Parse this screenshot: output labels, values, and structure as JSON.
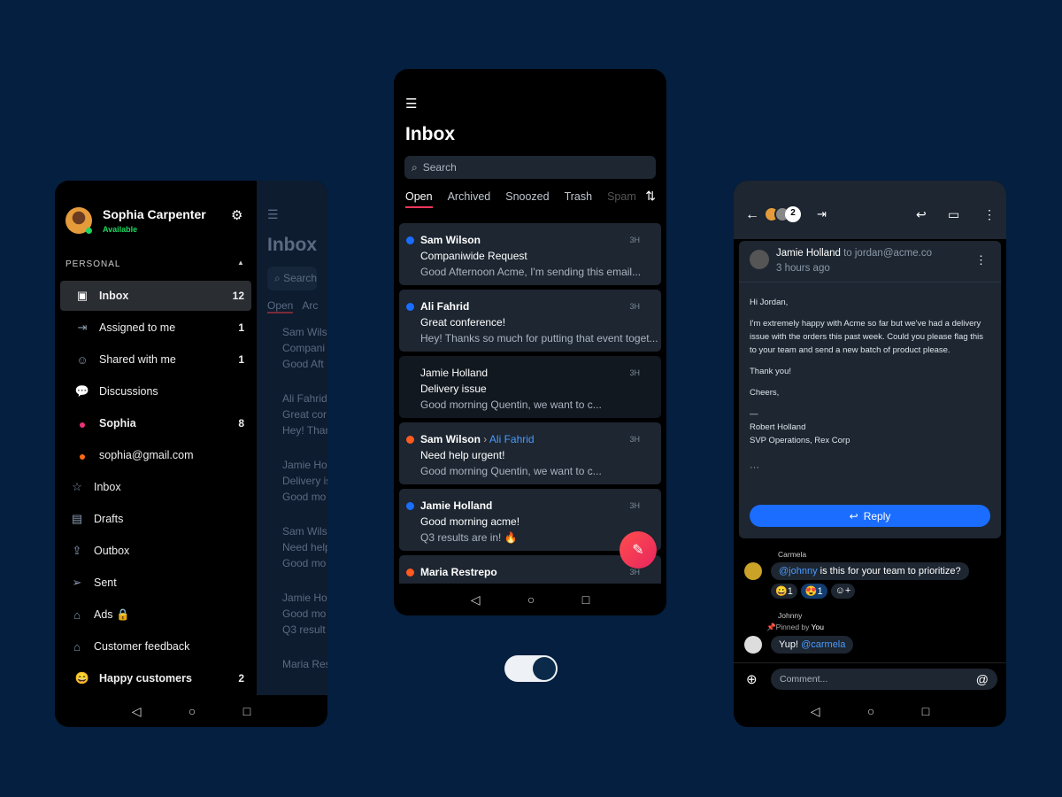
{
  "left": {
    "user": {
      "name": "Sophia Carpenter",
      "status": "Available"
    },
    "section": "PERSONAL",
    "items": [
      {
        "icon": "inbox-icon",
        "glyph": "▣",
        "label": "Inbox",
        "count": "12",
        "active": true
      },
      {
        "icon": "assign-icon",
        "glyph": "⇥",
        "label": "Assigned to me",
        "count": "1"
      },
      {
        "icon": "shared-icon",
        "glyph": "☺",
        "label": "Shared with me",
        "count": "1"
      },
      {
        "icon": "discussion-icon",
        "glyph": "💬",
        "label": "Discussions",
        "count": ""
      },
      {
        "icon": "dot-pink",
        "label": "Sophia",
        "count": "8",
        "color": "#e8337a",
        "bold": true
      },
      {
        "icon": "dot-orange",
        "label": "sophia@gmail.com",
        "count": "",
        "color": "#ff6a13"
      },
      {
        "icon": "star-icon",
        "glyph": "☆",
        "label": "Inbox",
        "count": ""
      },
      {
        "icon": "file-icon",
        "glyph": "▤",
        "label": "Drafts",
        "count": ""
      },
      {
        "icon": "outbox-icon",
        "glyph": "⇪",
        "label": "Outbox",
        "count": ""
      },
      {
        "icon": "send-icon",
        "glyph": "➢",
        "label": "Sent",
        "count": ""
      },
      {
        "icon": "tag-icon",
        "glyph": "⌂",
        "label": "Ads 🔒",
        "count": ""
      },
      {
        "icon": "tag-icon",
        "glyph": "⌂",
        "label": "Customer feedback",
        "count": ""
      },
      {
        "icon": "emoji-icon",
        "glyph": "😄",
        "label": "Happy customers",
        "count": "2",
        "bold": true
      }
    ],
    "under": {
      "title": "Inbox",
      "search": "Search",
      "tabs": [
        "Open",
        "Arc"
      ],
      "names": [
        "Sam Wils",
        "Compani",
        "Good Aft",
        "Ali Fahrid",
        "Great cor",
        "Hey! Than",
        "Jamie Hol",
        "Delivery is",
        "Good mo",
        "Sam Wils",
        "Need help",
        "Good mo",
        "Jamie Hol",
        "Good mo",
        "Q3 result",
        "Maria Res"
      ]
    }
  },
  "mid": {
    "title": "Inbox",
    "search_placeholder": "Search",
    "tabs": [
      "Open",
      "Archived",
      "Snoozed",
      "Trash",
      "Spam"
    ],
    "messages": [
      {
        "from": "Sam Wilson",
        "to": "",
        "subject": "Companiwide Request",
        "preview": "Good Afternoon Acme, I'm sending this email...",
        "time": "3H",
        "dot": "#1a6dff",
        "unread": true
      },
      {
        "from": "Ali Fahrid",
        "to": "",
        "subject": "Great conference!",
        "preview": "Hey! Thanks so much for putting that event toget...",
        "time": "3H",
        "dot": "#1a6dff",
        "unread": true
      },
      {
        "from": "Jamie Holland",
        "to": "",
        "subject": "Delivery issue",
        "preview": "Good morning Quentin, we want to c...",
        "time": "3H",
        "dot": "",
        "unread": false
      },
      {
        "from": "Sam Wilson",
        "to": "Ali Fahrid",
        "subject": "Need help urgent!",
        "preview": "Good morning Quentin, we want to c...",
        "time": "3H",
        "dot": "#ff5a1f",
        "unread": true
      },
      {
        "from": "Jamie Holland",
        "to": "",
        "subject": "Good morning acme!",
        "preview": "Q3 results are in! 🔥",
        "time": "3H",
        "dot": "#1a6dff",
        "unread": true
      },
      {
        "from": "Maria Restrepo",
        "to": "",
        "subject": "",
        "preview": "",
        "time": "3H",
        "dot": "#ff5a1f",
        "unread": true
      }
    ]
  },
  "right": {
    "participants_extra": "2",
    "email": {
      "from": "Jamie Holland",
      "to": "to jordan@acme.co",
      "time": "3 hours ago",
      "body": [
        "Hi Jordan,",
        "I'm extremely happy with Acme so far but we've had a delivery issue with the orders this past week. Could you please flag this to your team and send a new batch of product please.",
        "Thank you!",
        "Cheers,",
        "—\nRobert Holland\nSVP Operations, Rex Corp"
      ],
      "more": "···",
      "reply": "Reply"
    },
    "comments": [
      {
        "author": "Carmela",
        "mention": "@johnny",
        "text": " is this for your team to prioritize?",
        "reactions": [
          {
            "emoji": "😀",
            "count": "1"
          },
          {
            "emoji": "😍",
            "count": "1"
          }
        ]
      },
      {
        "author": "Johnny",
        "pinned": "Pinned by ",
        "pinned_by": "You",
        "text": "Yup! ",
        "mention": "@carmela"
      }
    ],
    "comment_placeholder": "Comment..."
  },
  "colors": {
    "background": "#041f3f",
    "accent": "#1a6dff",
    "fab": "#f5365c",
    "online": "#1ed760"
  }
}
